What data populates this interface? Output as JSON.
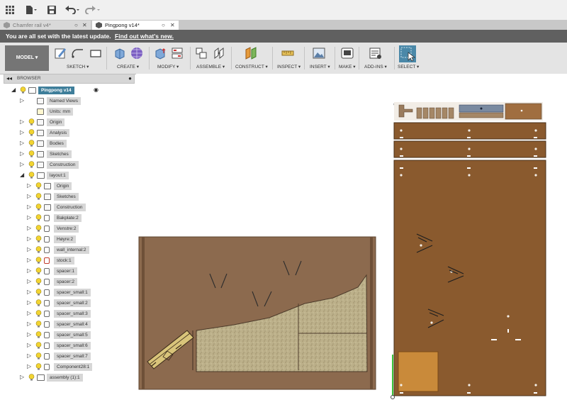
{
  "app": {
    "quick_icons": [
      "grid-icon",
      "file-icon",
      "save-icon",
      "undo-icon",
      "redo-icon"
    ]
  },
  "tabs": [
    {
      "label": "Chamfer rail v4*",
      "active": false
    },
    {
      "label": "Pingpong v14*",
      "active": true
    }
  ],
  "notification": {
    "text": "You are all set with the latest update.",
    "link": "Find out what's new."
  },
  "toolbar": {
    "workspace": "MODEL",
    "groups": [
      {
        "label": "SKETCH"
      },
      {
        "label": "CREATE"
      },
      {
        "label": "MODIFY"
      },
      {
        "label": "ASSEMBLE"
      },
      {
        "label": "CONSTRUCT"
      },
      {
        "label": "INSPECT"
      },
      {
        "label": "INSERT"
      },
      {
        "label": "MAKE"
      },
      {
        "label": "ADD-INS"
      },
      {
        "label": "SELECT"
      }
    ]
  },
  "browser": {
    "title": "BROWSER",
    "items": [
      {
        "label": "Pingpong v14",
        "level": 0,
        "type": "root",
        "expanded": true
      },
      {
        "label": "Named Views",
        "level": 1,
        "type": "folder",
        "expanded": false,
        "bulb": false
      },
      {
        "label": "Units: mm",
        "level": 1,
        "type": "units",
        "bulb": false
      },
      {
        "label": "Origin",
        "level": 1,
        "type": "folder",
        "expanded": false,
        "bulb": true
      },
      {
        "label": "Analysis",
        "level": 1,
        "type": "folder",
        "expanded": false,
        "bulb": true
      },
      {
        "label": "Bodies",
        "level": 1,
        "type": "folder",
        "expanded": false,
        "bulb": true
      },
      {
        "label": "Sketches",
        "level": 1,
        "type": "folder",
        "expanded": false,
        "bulb": true
      },
      {
        "label": "Construction",
        "level": 1,
        "type": "folder",
        "expanded": false,
        "bulb": true
      },
      {
        "label": "layout:1",
        "level": 1,
        "type": "component",
        "expanded": true,
        "bulb": true
      },
      {
        "label": "Origin",
        "level": 2,
        "type": "folder",
        "expanded": false,
        "bulb": true
      },
      {
        "label": "Sketches",
        "level": 2,
        "type": "folder",
        "expanded": false,
        "bulb": true
      },
      {
        "label": "Construction",
        "level": 2,
        "type": "folder",
        "expanded": false,
        "bulb": true
      },
      {
        "label": "Bakplate:2",
        "level": 2,
        "type": "body",
        "expanded": false,
        "bulb": true
      },
      {
        "label": "Venstre:2",
        "level": 2,
        "type": "body",
        "expanded": false,
        "bulb": true
      },
      {
        "label": "Høyre:2",
        "level": 2,
        "type": "body",
        "expanded": false,
        "bulb": true
      },
      {
        "label": "wall_internal:2",
        "level": 2,
        "type": "body",
        "expanded": false,
        "bulb": true
      },
      {
        "label": "stock:1",
        "level": 2,
        "type": "body-red",
        "expanded": false,
        "bulb": true
      },
      {
        "label": "spacer:1",
        "level": 2,
        "type": "body",
        "expanded": false,
        "bulb": true
      },
      {
        "label": "spacer:2",
        "level": 2,
        "type": "body",
        "expanded": false,
        "bulb": true
      },
      {
        "label": "spacer_small:1",
        "level": 2,
        "type": "body",
        "expanded": false,
        "bulb": true
      },
      {
        "label": "spacer_small:2",
        "level": 2,
        "type": "body",
        "expanded": false,
        "bulb": true
      },
      {
        "label": "spacer_small:3",
        "level": 2,
        "type": "body",
        "expanded": false,
        "bulb": true
      },
      {
        "label": "spacer_small:4",
        "level": 2,
        "type": "body",
        "expanded": false,
        "bulb": true
      },
      {
        "label": "spacer_small:5",
        "level": 2,
        "type": "body",
        "expanded": false,
        "bulb": true
      },
      {
        "label": "spacer_small:6",
        "level": 2,
        "type": "body",
        "expanded": false,
        "bulb": true
      },
      {
        "label": "spacer_small:7",
        "level": 2,
        "type": "body",
        "expanded": false,
        "bulb": true
      },
      {
        "label": "Component28:1",
        "level": 2,
        "type": "body",
        "expanded": false,
        "bulb": true
      },
      {
        "label": "assembly (1):1",
        "level": 1,
        "type": "component",
        "expanded": false,
        "bulb": true
      }
    ]
  },
  "colors": {
    "wood": "#8a5a2e",
    "wood_light": "#8c6a4e",
    "cork": "#b9ae86",
    "selected": "#3e7e9a",
    "bulb": "#f2d431",
    "notify_bg": "#606060"
  }
}
